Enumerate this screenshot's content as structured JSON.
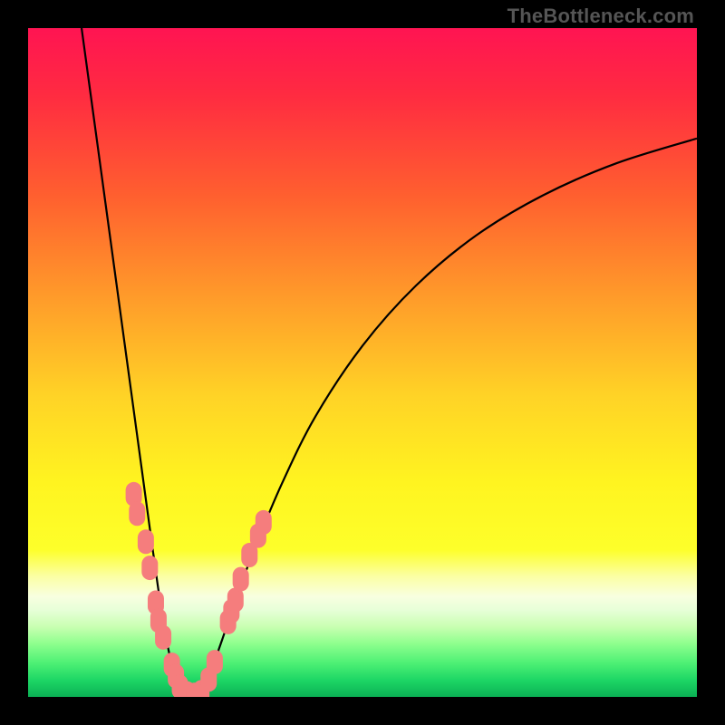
{
  "watermark": "TheBottleneck.com",
  "chart_data": {
    "type": "line",
    "title": "",
    "xlabel": "",
    "ylabel": "",
    "xlim": [
      0,
      100
    ],
    "ylim": [
      0,
      100
    ],
    "gradient_stops": [
      {
        "offset": 0.0,
        "color": "#ff1452"
      },
      {
        "offset": 0.1,
        "color": "#ff2b41"
      },
      {
        "offset": 0.25,
        "color": "#ff5f2f"
      },
      {
        "offset": 0.4,
        "color": "#ff9a2a"
      },
      {
        "offset": 0.55,
        "color": "#ffd326"
      },
      {
        "offset": 0.68,
        "color": "#fff420"
      },
      {
        "offset": 0.78,
        "color": "#fdff2a"
      },
      {
        "offset": 0.82,
        "color": "#fbffa5"
      },
      {
        "offset": 0.85,
        "color": "#f8ffe0"
      },
      {
        "offset": 0.87,
        "color": "#e7ffd8"
      },
      {
        "offset": 0.895,
        "color": "#c9ffb2"
      },
      {
        "offset": 0.92,
        "color": "#8fff8e"
      },
      {
        "offset": 0.95,
        "color": "#4cf074"
      },
      {
        "offset": 0.975,
        "color": "#1dd665"
      },
      {
        "offset": 1.0,
        "color": "#0bb054"
      }
    ],
    "series": [
      {
        "name": "bottleneck-curve",
        "x": [
          8.0,
          9.5,
          11.0,
          12.5,
          14.0,
          15.5,
          17.0,
          18.5,
          20.0,
          21.0,
          22.0,
          23.0,
          24.0,
          25.0,
          26.0,
          27.0,
          29.0,
          31.0,
          34.0,
          38.0,
          43.0,
          50.0,
          58.0,
          67.0,
          77.0,
          88.0,
          100.0
        ],
        "y": [
          100.0,
          89.0,
          78.0,
          67.0,
          56.0,
          45.0,
          34.0,
          23.0,
          12.5,
          7.0,
          3.0,
          1.0,
          0.3,
          0.2,
          1.0,
          3.0,
          8.5,
          14.5,
          22.5,
          32.0,
          42.0,
          52.5,
          61.5,
          69.0,
          75.0,
          79.8,
          83.5
        ]
      }
    ],
    "markers": {
      "name": "data-points",
      "color": "#f57d7d",
      "points": [
        {
          "x": 15.8,
          "y": 30.3
        },
        {
          "x": 16.3,
          "y": 27.4
        },
        {
          "x": 17.6,
          "y": 23.2
        },
        {
          "x": 18.2,
          "y": 19.3
        },
        {
          "x": 19.1,
          "y": 14.1
        },
        {
          "x": 19.5,
          "y": 11.4
        },
        {
          "x": 20.2,
          "y": 8.9
        },
        {
          "x": 21.5,
          "y": 4.8
        },
        {
          "x": 22.1,
          "y": 3.1
        },
        {
          "x": 22.7,
          "y": 1.5
        },
        {
          "x": 23.8,
          "y": 0.5
        },
        {
          "x": 24.9,
          "y": 0.3
        },
        {
          "x": 25.9,
          "y": 0.7
        },
        {
          "x": 27.0,
          "y": 2.6
        },
        {
          "x": 27.9,
          "y": 5.2
        },
        {
          "x": 29.9,
          "y": 11.2
        },
        {
          "x": 30.4,
          "y": 12.8
        },
        {
          "x": 31.0,
          "y": 14.5
        },
        {
          "x": 31.8,
          "y": 17.6
        },
        {
          "x": 33.1,
          "y": 21.2
        },
        {
          "x": 34.4,
          "y": 24.1
        },
        {
          "x": 35.2,
          "y": 26.1
        }
      ]
    }
  }
}
